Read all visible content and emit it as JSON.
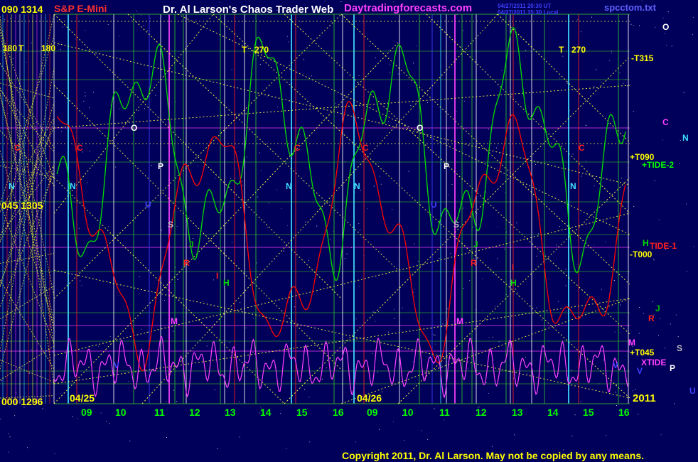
{
  "header": {
    "ticks_top": "090  1314",
    "instrument": "S&P E-Mini",
    "title": "Dr. Al Larson's Chaos Trader Web",
    "site": "Daytradingforecasts.com",
    "stamp_line1": "04/27/2011 20:30 UT",
    "stamp_line2": "04/27/2011 15:30 Local",
    "file": "spcctom.txt"
  },
  "left_scale": {
    "mid": "045  1305",
    "bottom": "000  1296"
  },
  "footer": {
    "copyright": "Copyright 2011, Dr. Al Larson. May not be copied by any means.",
    "year": "2011"
  },
  "colors": {
    "background": "#00005a",
    "price_line": "#ff0000",
    "tide2_line": "#00e000",
    "xtide_line": "#ff40ff",
    "trend_lines": "#ffff40",
    "hour_labels": "#00ff00",
    "title": "#ffffff",
    "instrument": "#ff3030",
    "site": "#ff40ff",
    "file": "#6060ff",
    "copyright": "#ffff00"
  },
  "chart_data": {
    "type": "line",
    "title": "S&P E-Mini",
    "dates": [
      "04/25",
      "04/26"
    ],
    "x_tick_labels": [
      "09",
      "10",
      "11",
      "12",
      "13",
      "14",
      "15",
      "16",
      "09",
      "10",
      "11",
      "12",
      "13",
      "14",
      "15",
      "16"
    ],
    "y_price_ticks": [
      "1314",
      "1305",
      "1296"
    ],
    "y_angle_ticks": [
      "090",
      "045",
      "000"
    ],
    "ylim": [
      1296,
      1314
    ],
    "grid": true,
    "series": [
      {
        "name": "TIDE-1",
        "color": "#ff0000"
      },
      {
        "name": "TIDE-2",
        "color": "#00e000"
      },
      {
        "name": "XTIDE",
        "color": "#ff40ff"
      }
    ],
    "right_labels": [
      {
        "text": "O",
        "color": "#ffffff"
      },
      {
        "text": "-T315",
        "color": "#ffff00"
      },
      {
        "text": "C",
        "color": "#ff40ff"
      },
      {
        "text": "N",
        "color": "#40e0ff"
      },
      {
        "text": "+T090",
        "color": "#ffff00"
      },
      {
        "text": "+TIDE-2",
        "color": "#00ff00"
      },
      {
        "text": "H",
        "color": "#00e000"
      },
      {
        "text": "TIDE-1",
        "color": "#ff2020"
      },
      {
        "text": "-T000",
        "color": "#ffff00"
      },
      {
        "text": "J",
        "color": "#00c000"
      },
      {
        "text": "R",
        "color": "#ff2020"
      },
      {
        "text": "M",
        "color": "#ff40ff"
      },
      {
        "text": "+T045",
        "color": "#ffff00"
      },
      {
        "text": "S",
        "color": "#c0c0c0"
      },
      {
        "text": "XTIDE",
        "color": "#ff40ff"
      },
      {
        "text": "P",
        "color": "#ffffff"
      },
      {
        "text": "V",
        "color": "#4040ff"
      },
      {
        "text": "U",
        "color": "#4040ff"
      }
    ],
    "chart_labels": [
      {
        "text": "180",
        "color": "#ffff00"
      },
      {
        "text": "T",
        "color": "#ffff00"
      },
      {
        "text": "180",
        "color": "#ffff00"
      },
      {
        "text": "T",
        "color": "#ffff00"
      },
      {
        "text": "270",
        "color": "#ffff00"
      },
      {
        "text": "T",
        "color": "#ffff00"
      },
      {
        "text": "270",
        "color": "#ffff00"
      },
      {
        "text": "O",
        "color": "#ffffff"
      },
      {
        "text": "O",
        "color": "#ffffff"
      },
      {
        "text": "P",
        "color": "#ffffff"
      },
      {
        "text": "P",
        "color": "#ffffff"
      },
      {
        "text": "C",
        "color": "#ff2020"
      },
      {
        "text": "C",
        "color": "#ff2020"
      },
      {
        "text": "C",
        "color": "#ff2020"
      },
      {
        "text": "C",
        "color": "#ff2020"
      },
      {
        "text": "C",
        "color": "#ff2020"
      },
      {
        "text": "N",
        "color": "#40e0ff"
      },
      {
        "text": "N",
        "color": "#40e0ff"
      },
      {
        "text": "N",
        "color": "#40e0ff"
      },
      {
        "text": "N",
        "color": "#40e0ff"
      },
      {
        "text": "N",
        "color": "#40e0ff"
      },
      {
        "text": "U",
        "color": "#4040ff"
      },
      {
        "text": "U",
        "color": "#4040ff"
      },
      {
        "text": "S",
        "color": "#c0c0c0"
      },
      {
        "text": "S",
        "color": "#c0c0c0"
      },
      {
        "text": "J",
        "color": "#00c000"
      },
      {
        "text": "J",
        "color": "#00c000"
      },
      {
        "text": "R",
        "color": "#ff2020"
      },
      {
        "text": "R",
        "color": "#ff2020"
      },
      {
        "text": "H",
        "color": "#00e000"
      },
      {
        "text": "H",
        "color": "#00e000"
      },
      {
        "text": "M",
        "color": "#ff40ff"
      },
      {
        "text": "M",
        "color": "#ff40ff"
      },
      {
        "text": "V",
        "color": "#4040ff"
      },
      {
        "text": "V",
        "color": "#4040ff"
      },
      {
        "text": "I",
        "color": "#ff2020"
      },
      {
        "text": "I",
        "color": "#ff2020"
      }
    ]
  }
}
